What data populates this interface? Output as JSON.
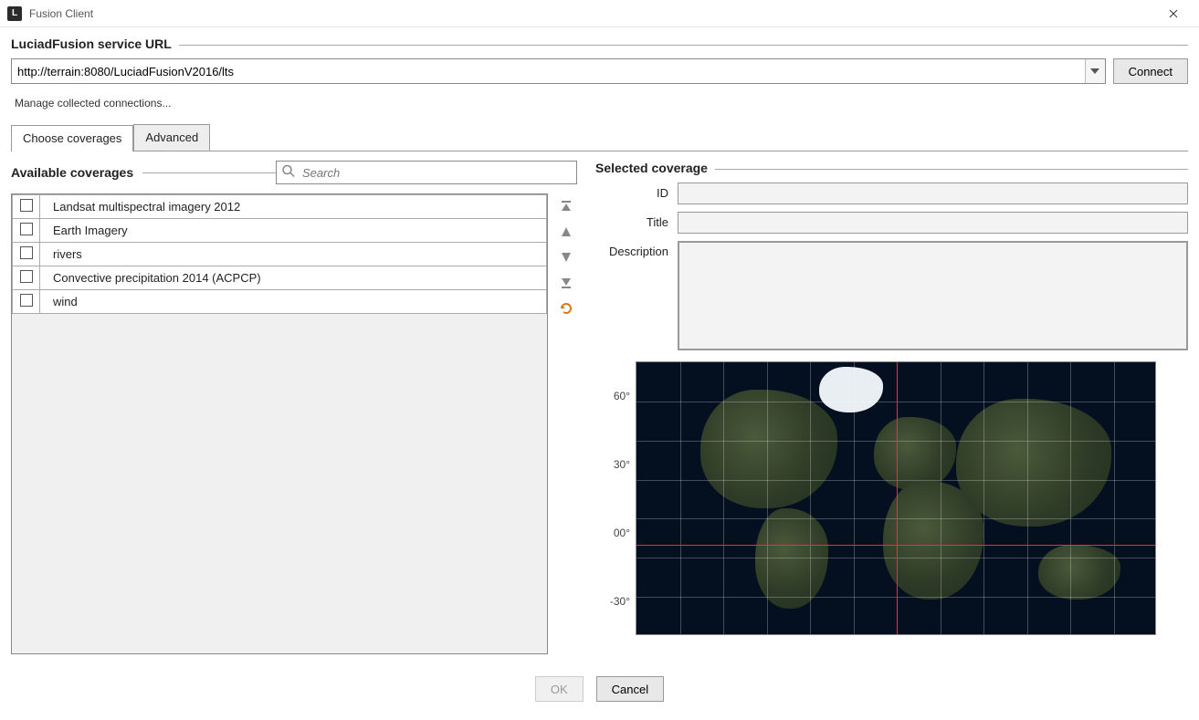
{
  "window": {
    "title": "Fusion Client"
  },
  "service": {
    "legend": "LuciadFusion service URL",
    "url": "http://terrain:8080/LuciadFusionV2016/lts",
    "connect_label": "Connect",
    "manage_link": "Manage collected connections..."
  },
  "tabs": {
    "choose": "Choose coverages",
    "advanced": "Advanced"
  },
  "available": {
    "legend": "Available coverages",
    "search_placeholder": "Search",
    "items": [
      "Landsat multispectral imagery 2012",
      "Earth Imagery",
      "rivers",
      "Convective precipitation 2014 (ACPCP)",
      "wind"
    ]
  },
  "selected": {
    "legend": "Selected coverage",
    "id_label": "ID",
    "title_label": "Title",
    "desc_label": "Description",
    "id": "",
    "title": "",
    "description": ""
  },
  "map": {
    "lat_labels": [
      "60°",
      "30°",
      "00°",
      "-30°"
    ]
  },
  "footer": {
    "ok": "OK",
    "cancel": "Cancel"
  }
}
